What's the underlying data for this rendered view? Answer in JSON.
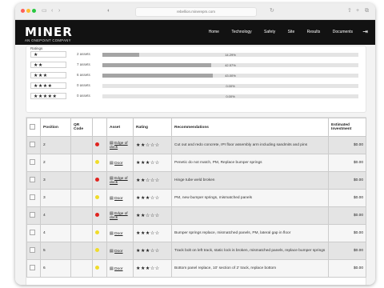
{
  "browser": {
    "url": "rebellion.minerepm.com"
  },
  "nav": {
    "brand": "MINER",
    "brand_sub": "AN ONEPOINT COMPANY",
    "menu": [
      "Home",
      "Technology",
      "Safety",
      "Site",
      "Results",
      "Documents"
    ]
  },
  "ratings": {
    "title": "Ratings",
    "rows": [
      {
        "stars": "★",
        "count": "2 assets",
        "percent": "14.29%",
        "fraction": 0.1429
      },
      {
        "stars": "★★",
        "count": "7 assets",
        "percent": "42.57%",
        "fraction": 0.4257
      },
      {
        "stars": "★★★",
        "count": "6 assets",
        "percent": "43.00%",
        "fraction": 0.43
      },
      {
        "stars": "★★★★",
        "count": "0 assets",
        "percent": "0.00%",
        "fraction": 0
      },
      {
        "stars": "★★★★★",
        "count": "0 assets",
        "percent": "0.00%",
        "fraction": 0
      }
    ]
  },
  "table": {
    "headers": [
      "",
      "Position",
      "QR Code",
      "",
      "Asset",
      "Rating",
      "Recommendations",
      "Estimated Investment"
    ],
    "rows": [
      {
        "position": "2",
        "severity": "#e0241f",
        "asset": "Edge of dock",
        "rating": "★★☆☆☆",
        "rec": "Cut out and redo concrete, IPI floor assembly arm including sandmits and pins",
        "inv": "$0.00"
      },
      {
        "position": "2",
        "severity": "#f0dc2a",
        "asset": "Door",
        "rating": "★★★☆☆",
        "rec": "Penetic do not match, PM, Replace bumper springs",
        "inv": "$0.00"
      },
      {
        "position": "3",
        "severity": "#e0241f",
        "asset": "Edge of dock",
        "rating": "★★☆☆☆",
        "rec": "Hinge tube weld broken",
        "inv": "$0.00"
      },
      {
        "position": "3",
        "severity": "#f0dc2a",
        "asset": "Door",
        "rating": "★★★☆☆",
        "rec": "PM, new bumper springs, mismatched panels",
        "inv": "$0.00"
      },
      {
        "position": "4",
        "severity": "#e0241f",
        "asset": "Edge of dock",
        "rating": "★★☆☆☆",
        "rec": "",
        "inv": "$0.00"
      },
      {
        "position": "4",
        "severity": "#f0dc2a",
        "asset": "Door",
        "rating": "★★★☆☆",
        "rec": "Bumper springs replace, mismatched panels, PM, lateral gap in floor",
        "inv": "$0.00"
      },
      {
        "position": "5",
        "severity": "#f0dc2a",
        "asset": "Door",
        "rating": "★★★☆☆",
        "rec": "Track bolt on left track, static lock is broken, mismatched panels, replace bumper springs",
        "inv": "$0.00"
      },
      {
        "position": "6",
        "severity": "#f0dc2a",
        "asset": "Door",
        "rating": "★★★☆☆",
        "rec": "Bottom panel replace, 10' section of 2' track, replace bottom",
        "inv": "$0.00"
      }
    ]
  }
}
